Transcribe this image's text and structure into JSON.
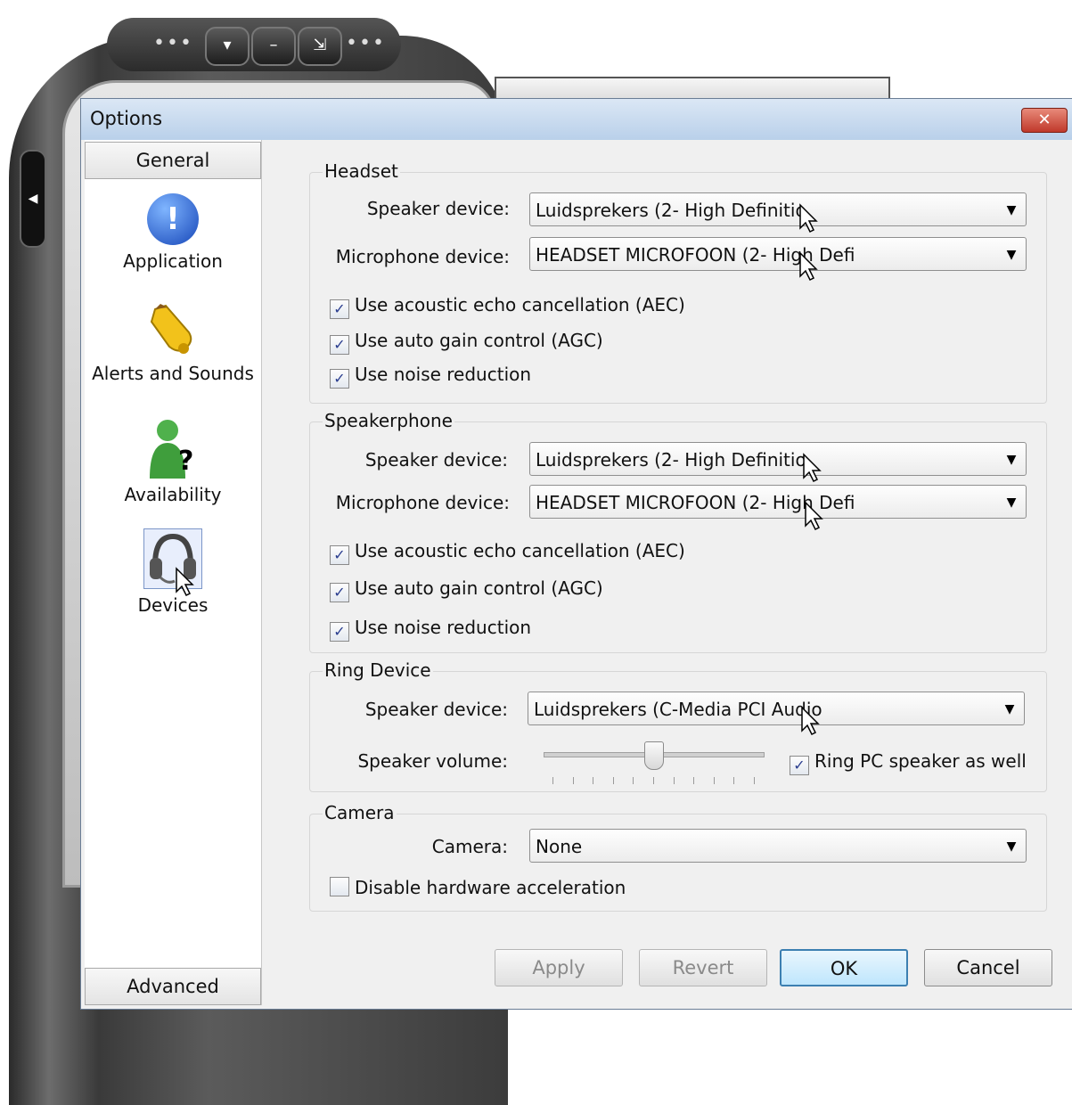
{
  "window": {
    "title": "Options",
    "close_glyph": "✕"
  },
  "background_app": {
    "buttons": [
      "▾",
      "–",
      "⇲"
    ],
    "dots": "•••"
  },
  "sidebar": {
    "top_tab": "General",
    "bottom_tab": "Advanced",
    "items": [
      {
        "label": "Application",
        "icon": "info-icon",
        "glyph": "!"
      },
      {
        "label": "Alerts and Sounds",
        "icon": "bell-icon"
      },
      {
        "label": "Availability",
        "icon": "availability-icon"
      },
      {
        "label": "Devices",
        "icon": "headset-icon"
      }
    ]
  },
  "headset": {
    "title": "Headset",
    "speaker_label": "Speaker device:",
    "speaker_value": "Luidsprekers (2- High Definitio",
    "mic_label": "Microphone device:",
    "mic_value": "HEADSET MICROFOON (2- High Defi",
    "aec": "Use acoustic echo cancellation (AEC)",
    "agc": "Use auto gain control (AGC)",
    "noise": "Use noise reduction",
    "aec_checked": true,
    "agc_checked": true,
    "noise_checked": true
  },
  "speakerphone": {
    "title": "Speakerphone",
    "speaker_label": "Speaker device:",
    "speaker_value": "Luidsprekers (2- High Definitio",
    "mic_label": "Microphone device:",
    "mic_value": "HEADSET MICROFOON (2- High Defi",
    "aec": "Use acoustic echo cancellation (AEC)",
    "agc": "Use auto gain control (AGC)",
    "noise": "Use noise reduction",
    "aec_checked": true,
    "agc_checked": true,
    "noise_checked": true
  },
  "ring": {
    "title": "Ring Device",
    "speaker_label": "Speaker device:",
    "speaker_value": "Luidsprekers (C-Media PCI Audio",
    "volume_label": "Speaker volume:",
    "volume_level": 0.5,
    "ring_pc": "Ring PC speaker as well",
    "ring_pc_checked": true
  },
  "camera": {
    "title": "Camera",
    "camera_label": "Camera:",
    "camera_value": "None",
    "disable_hw": "Disable hardware acceleration",
    "disable_hw_checked": false
  },
  "buttons": {
    "apply": "Apply",
    "revert": "Revert",
    "ok": "OK",
    "cancel": "Cancel"
  },
  "colors": {
    "titlebar": "#c7d9ee",
    "close": "#c0392b",
    "default_button": "#3c7fb1"
  }
}
